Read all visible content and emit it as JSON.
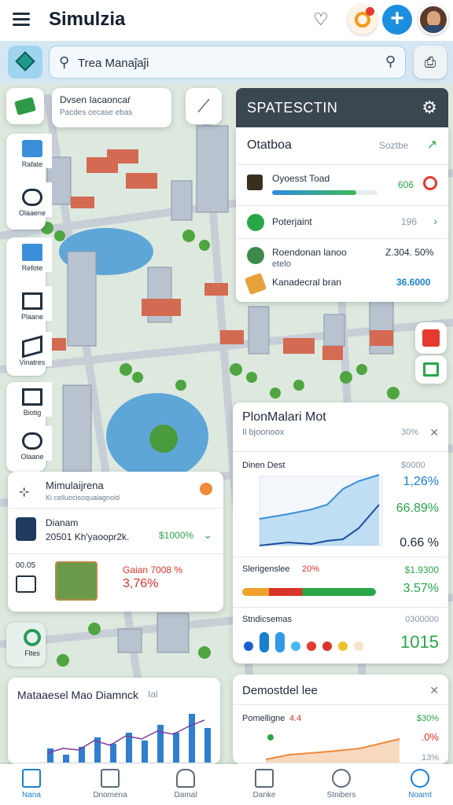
{
  "app": {
    "title": "Simulzia"
  },
  "search": {
    "value": "Trea Manaĵaĵi"
  },
  "scenario": {
    "title": "Dvsen Iacaoncaŕ",
    "subtitle": "Pacdes cecase ebas"
  },
  "rail": [
    "Rafate",
    "Olaaene",
    "Refote",
    "Plaane",
    "Vinatres",
    "Biotig",
    "Olaane",
    "Fltes"
  ],
  "panel": {
    "title": "SPATESCTIN",
    "section": "Otatboa",
    "section_value": "Soztbe",
    "rows": [
      {
        "label": "Oyoesst Toad",
        "value": "606"
      },
      {
        "label": "Poterjaint",
        "value": "196"
      },
      {
        "label": "Roendonan lanoo",
        "sub": "etelo",
        "value": "Z.304. 50%"
      },
      {
        "label": "Kanadecral bran",
        "value": "36.6000"
      }
    ],
    "progress": 0.8
  },
  "pm_card": {
    "title": "PlonMalari Mot",
    "subtitle": "Il bjoonoox",
    "subtitle_value": "30%",
    "chart_header": "Dinen Dest",
    "chart_header_value": "$0000",
    "stats": [
      {
        "value": "1,26%",
        "color": "#1a7fd0"
      },
      {
        "value": "66.89%",
        "color": "#2aa64a"
      },
      {
        "value": "0.66 %",
        "color": "#1e2a3a"
      }
    ],
    "segment_label": "Slerigenslee",
    "segment_pct": "20%",
    "segment_value": "$1.9300",
    "segment_stat": "3.57%",
    "dots_label": "Stndicsemas",
    "dots_value": "0300000",
    "dots_stat": "1015"
  },
  "sub_card": {
    "title": "Demostdel lee",
    "label": "Pomelligne",
    "label_value": "4.4",
    "pct1": "$30%",
    "pct2": ".0%",
    "pct3": "13%"
  },
  "mid_left": {
    "title": "Mimulaijrena",
    "subtitle": "Ki celluocisoquaiagnoid",
    "item_title": "Dianam",
    "item_sub": "20501 Kh'yaoopr2k.",
    "item_value": "$1000%",
    "lower_title": "Gaian 7008 %",
    "lower_value": "3,76%",
    "left_label": "00.05"
  },
  "bottom_left": {
    "title": "Mataaesel Mao Diamnck",
    "title_suffix": "Ial"
  },
  "nav": [
    "Nana",
    "Dnomena",
    "Damal",
    "Danke",
    "Stnibers",
    "Noamt"
  ],
  "colors": {
    "accent": "#1a7fd0",
    "positive": "#2aa64a",
    "negative": "#d8342a"
  }
}
